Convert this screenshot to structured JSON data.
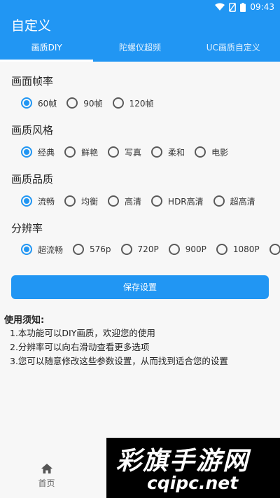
{
  "status_bar": {
    "time": "09:43",
    "icons": [
      "wifi-icon",
      "sim-no-signal-icon",
      "battery-icon"
    ]
  },
  "app_bar": {
    "title": "自定义"
  },
  "tabs": [
    {
      "label": "画质DIY",
      "active": true
    },
    {
      "label": "陀螺仪超频",
      "active": false
    },
    {
      "label": "UC画质自定义",
      "active": false
    }
  ],
  "sections": {
    "fps": {
      "title": "画面帧率",
      "options": [
        "60帧",
        "90帧",
        "120帧"
      ],
      "selected": "60帧"
    },
    "style": {
      "title": "画质风格",
      "options": [
        "经典",
        "鲜艳",
        "写真",
        "柔和",
        "电影"
      ],
      "selected": "经典"
    },
    "quality": {
      "title": "画质品质",
      "options": [
        "流畅",
        "均衡",
        "高清",
        "HDR高清",
        "超高清"
      ],
      "selected": "流畅"
    },
    "resolution": {
      "title": "分辨率",
      "options": [
        "超流畅",
        "576p",
        "720P",
        "900P",
        "1080P"
      ],
      "selected": "超流畅"
    }
  },
  "save_button": "保存设置",
  "notes": {
    "title": "使用须知:",
    "items": [
      "1.本功能可以DIY画质，欢迎您的使用",
      "2.分辨率可以向右滑动查看更多选项",
      "3.您可以随意修改这些参数设置，从而找到适合您的设置"
    ]
  },
  "bottom_nav": {
    "home_label": "首页",
    "icon": "home-icon"
  },
  "watermark": {
    "line1": "彩旗手游网",
    "line2": "cqipc.net"
  },
  "colors": {
    "accent": "#2196f3",
    "background": "#f7f7f7"
  }
}
